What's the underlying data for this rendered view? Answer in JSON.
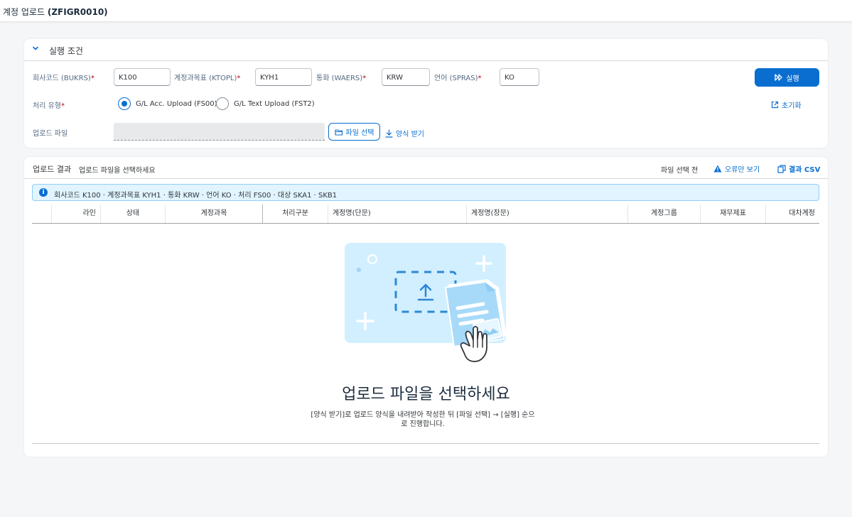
{
  "window": {
    "title_prefix": "계정 업로드",
    "title_code": "(ZFIGR0010)"
  },
  "criteria": {
    "section_title": "실행 조건",
    "company_code": {
      "label": "회사코드 (BUKRS)",
      "value": "K100"
    },
    "chart_of_accounts": {
      "label": "계정과목표 (KTOPL)",
      "value": "KYH1"
    },
    "currency": {
      "label": "통화 (WAERS)",
      "value": "KRW"
    },
    "language": {
      "label": "언어 (SPRAS)",
      "value": "KO"
    },
    "required_mark": "*",
    "run_button": "실행",
    "process_type": {
      "label": "처리 유형",
      "options": [
        {
          "label": "G/L Acc. Upload (FS00)",
          "selected": true
        },
        {
          "label": "G/L Text Upload (FST2)",
          "selected": false
        }
      ]
    },
    "reset_link": "초기화",
    "upload_file": {
      "label": "업로드 파일",
      "value": ""
    },
    "file_select_button": "파일 선택",
    "template_link": "양식 받기"
  },
  "results": {
    "title": "업로드 결과",
    "subtitle": "업로드 파일을 선택하세요",
    "status": "파일 선택 전",
    "errors_only_link": "오류만 보기",
    "csv_link": "결과 CSV",
    "info": "회사코드 K100 · 계정과목표 KYH1 · 통화 KRW · 언어 KO · 처리 FS00 · 대상 SKA1 · SKB1",
    "columns": [
      "라인",
      "상태",
      "계정과목",
      "처리구분",
      "계정명(단문)",
      "계정명(장문)",
      "계정그룹",
      "재무제표",
      "대차계정"
    ],
    "empty_title": "업로드 파일을 선택하세요",
    "empty_description_line1": "[양식 받기]로 업로드 양식을 내려받아 작성한 뒤 [파일 선택] → [실행] 순으",
    "empty_description_line2": "로 진행합니다."
  },
  "colors": {
    "accent": "#0a6ed1",
    "required": "#bb0000",
    "info_background": "#e1f4ff",
    "illustration": "#d1efff"
  }
}
